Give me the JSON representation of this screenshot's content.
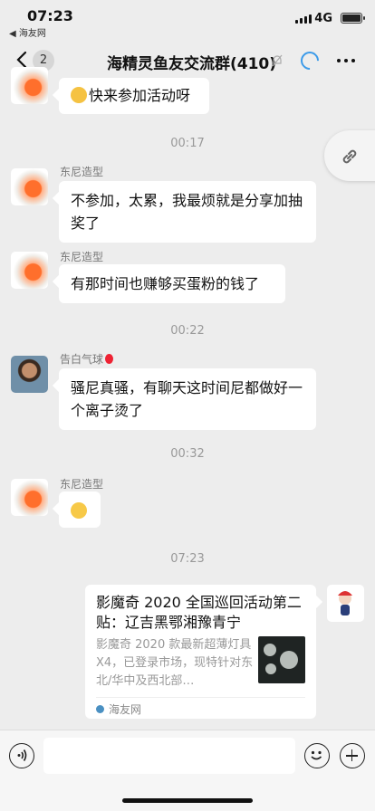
{
  "status": {
    "time": "07:23",
    "back_app": "◀ 海友网",
    "network": "4G"
  },
  "nav": {
    "unread": "2",
    "title": "海精灵鱼友交流群(410)"
  },
  "timestamps": [
    "00:17",
    "00:22",
    "00:32",
    "07:23"
  ],
  "messages": [
    {
      "sender": "",
      "text": "快来参加活动呀"
    },
    {
      "sender": "东尼造型",
      "text": "不参加，太累，我最烦就是分享加抽奖了"
    },
    {
      "sender": "东尼造型",
      "text": "有那时间也赚够买蛋粉的钱了"
    },
    {
      "sender": "告白气球",
      "text": "骚尼真骚，有聊天这时间尼都做好一个离子烫了"
    },
    {
      "sender": "东尼造型",
      "text": ""
    }
  ],
  "card": {
    "title": "影魔奇 2020 全国巡回活动第二贴：辽吉黑鄂湘豫青宁",
    "desc": "影魔奇 2020 款最新超薄灯具 X4，已登录市场，现特针对东北/华中及西北部…",
    "source": "海友网"
  },
  "colors": {
    "accent": "#3d9be9",
    "background": "#ededed"
  }
}
